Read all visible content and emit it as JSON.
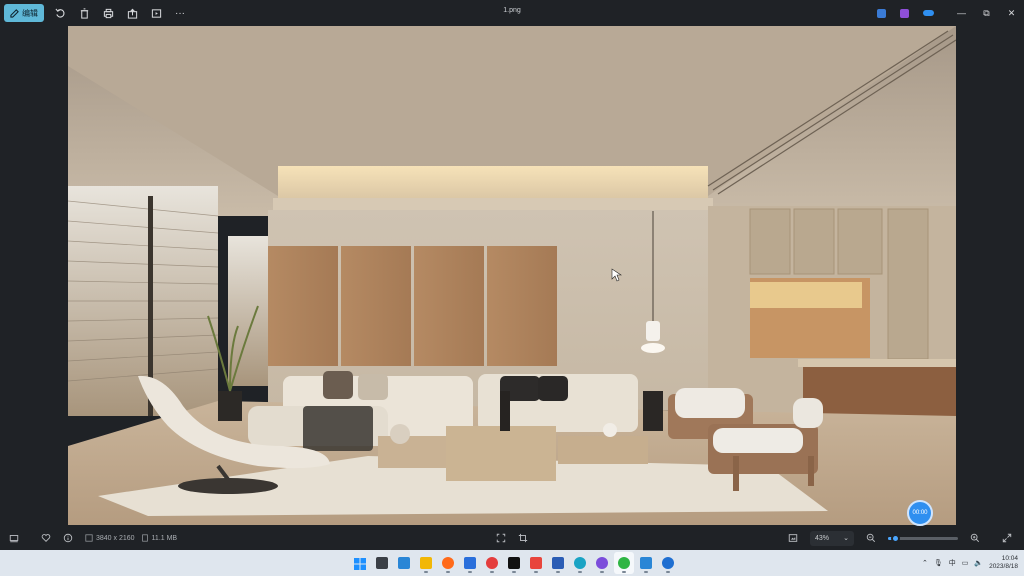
{
  "window": {
    "title": "1.png",
    "edit_label": "编辑"
  },
  "toolbar": {
    "icons": [
      "rotate-icon",
      "delete-icon",
      "print-icon",
      "share-icon",
      "slideshow-icon",
      "more-icon"
    ],
    "more_label": "···"
  },
  "title_right": {
    "apps": [
      {
        "name": "clipchamp-icon",
        "color": "#3a7bd5"
      },
      {
        "name": "photos-app-icon",
        "color": "#8e4fd8"
      },
      {
        "name": "onedrive-icon",
        "color": "#2f8ff0"
      }
    ],
    "minimize": "—",
    "restore": "⧉",
    "close": "✕"
  },
  "image": {
    "timer_label": "00:00"
  },
  "status": {
    "dimensions": "3840 x 2160",
    "file_size": "11.1 MB",
    "zoom": "43%",
    "zoom_level": 0.1
  },
  "taskbar": {
    "apps": [
      {
        "name": "start-icon",
        "color": "#1e90ff"
      },
      {
        "name": "task-view-icon",
        "color": "#3a3f46"
      },
      {
        "name": "widgets-icon",
        "color": "#2a86d6"
      },
      {
        "name": "file-explorer-icon",
        "color": "#f2b705"
      },
      {
        "name": "firefox-icon",
        "color": "#ff6a1a"
      },
      {
        "name": "store-icon",
        "color": "#2a6fdb"
      },
      {
        "name": "weibo-icon",
        "color": "#e43d3d"
      },
      {
        "name": "tiktok-icon",
        "color": "#111111"
      },
      {
        "name": "wps-icon",
        "color": "#e8453c"
      },
      {
        "name": "word-icon",
        "color": "#2b5db5"
      },
      {
        "name": "edge-icon",
        "color": "#1aa3c4"
      },
      {
        "name": "chat-icon",
        "color": "#7b4ddb"
      },
      {
        "name": "wechat-icon",
        "color": "#2fb544"
      },
      {
        "name": "photos-icon",
        "color": "#2a86d6"
      },
      {
        "name": "settings-app-icon",
        "color": "#1f6fd1"
      }
    ],
    "active_index": 12,
    "time": "10:04",
    "date": "2023/8/18",
    "ime_label": "中"
  }
}
